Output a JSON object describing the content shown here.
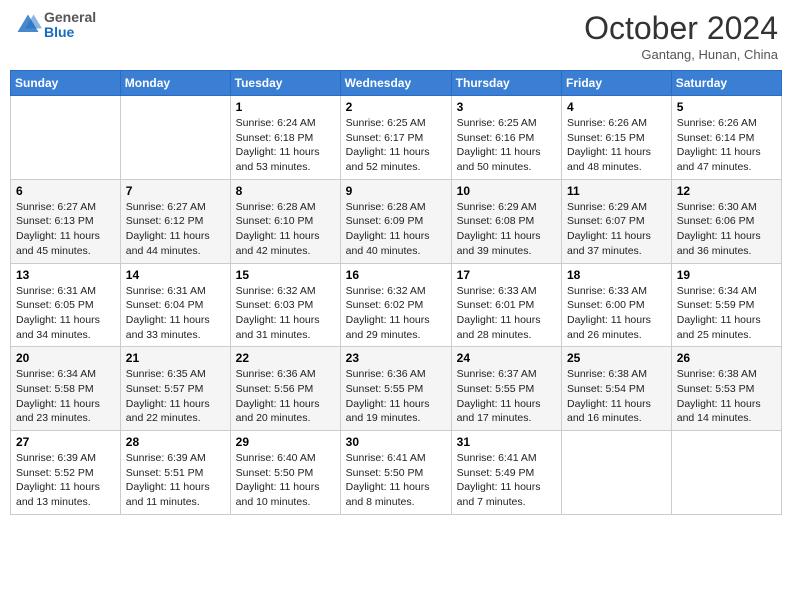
{
  "header": {
    "logo": {
      "general": "General",
      "blue": "Blue"
    },
    "title": "October 2024",
    "location": "Gantang, Hunan, China"
  },
  "days_of_week": [
    "Sunday",
    "Monday",
    "Tuesday",
    "Wednesday",
    "Thursday",
    "Friday",
    "Saturday"
  ],
  "weeks": [
    [
      {
        "day": "",
        "sunrise": "",
        "sunset": "",
        "daylight": ""
      },
      {
        "day": "",
        "sunrise": "",
        "sunset": "",
        "daylight": ""
      },
      {
        "day": "1",
        "sunrise": "Sunrise: 6:24 AM",
        "sunset": "Sunset: 6:18 PM",
        "daylight": "Daylight: 11 hours and 53 minutes."
      },
      {
        "day": "2",
        "sunrise": "Sunrise: 6:25 AM",
        "sunset": "Sunset: 6:17 PM",
        "daylight": "Daylight: 11 hours and 52 minutes."
      },
      {
        "day": "3",
        "sunrise": "Sunrise: 6:25 AM",
        "sunset": "Sunset: 6:16 PM",
        "daylight": "Daylight: 11 hours and 50 minutes."
      },
      {
        "day": "4",
        "sunrise": "Sunrise: 6:26 AM",
        "sunset": "Sunset: 6:15 PM",
        "daylight": "Daylight: 11 hours and 48 minutes."
      },
      {
        "day": "5",
        "sunrise": "Sunrise: 6:26 AM",
        "sunset": "Sunset: 6:14 PM",
        "daylight": "Daylight: 11 hours and 47 minutes."
      }
    ],
    [
      {
        "day": "6",
        "sunrise": "Sunrise: 6:27 AM",
        "sunset": "Sunset: 6:13 PM",
        "daylight": "Daylight: 11 hours and 45 minutes."
      },
      {
        "day": "7",
        "sunrise": "Sunrise: 6:27 AM",
        "sunset": "Sunset: 6:12 PM",
        "daylight": "Daylight: 11 hours and 44 minutes."
      },
      {
        "day": "8",
        "sunrise": "Sunrise: 6:28 AM",
        "sunset": "Sunset: 6:10 PM",
        "daylight": "Daylight: 11 hours and 42 minutes."
      },
      {
        "day": "9",
        "sunrise": "Sunrise: 6:28 AM",
        "sunset": "Sunset: 6:09 PM",
        "daylight": "Daylight: 11 hours and 40 minutes."
      },
      {
        "day": "10",
        "sunrise": "Sunrise: 6:29 AM",
        "sunset": "Sunset: 6:08 PM",
        "daylight": "Daylight: 11 hours and 39 minutes."
      },
      {
        "day": "11",
        "sunrise": "Sunrise: 6:29 AM",
        "sunset": "Sunset: 6:07 PM",
        "daylight": "Daylight: 11 hours and 37 minutes."
      },
      {
        "day": "12",
        "sunrise": "Sunrise: 6:30 AM",
        "sunset": "Sunset: 6:06 PM",
        "daylight": "Daylight: 11 hours and 36 minutes."
      }
    ],
    [
      {
        "day": "13",
        "sunrise": "Sunrise: 6:31 AM",
        "sunset": "Sunset: 6:05 PM",
        "daylight": "Daylight: 11 hours and 34 minutes."
      },
      {
        "day": "14",
        "sunrise": "Sunrise: 6:31 AM",
        "sunset": "Sunset: 6:04 PM",
        "daylight": "Daylight: 11 hours and 33 minutes."
      },
      {
        "day": "15",
        "sunrise": "Sunrise: 6:32 AM",
        "sunset": "Sunset: 6:03 PM",
        "daylight": "Daylight: 11 hours and 31 minutes."
      },
      {
        "day": "16",
        "sunrise": "Sunrise: 6:32 AM",
        "sunset": "Sunset: 6:02 PM",
        "daylight": "Daylight: 11 hours and 29 minutes."
      },
      {
        "day": "17",
        "sunrise": "Sunrise: 6:33 AM",
        "sunset": "Sunset: 6:01 PM",
        "daylight": "Daylight: 11 hours and 28 minutes."
      },
      {
        "day": "18",
        "sunrise": "Sunrise: 6:33 AM",
        "sunset": "Sunset: 6:00 PM",
        "daylight": "Daylight: 11 hours and 26 minutes."
      },
      {
        "day": "19",
        "sunrise": "Sunrise: 6:34 AM",
        "sunset": "Sunset: 5:59 PM",
        "daylight": "Daylight: 11 hours and 25 minutes."
      }
    ],
    [
      {
        "day": "20",
        "sunrise": "Sunrise: 6:34 AM",
        "sunset": "Sunset: 5:58 PM",
        "daylight": "Daylight: 11 hours and 23 minutes."
      },
      {
        "day": "21",
        "sunrise": "Sunrise: 6:35 AM",
        "sunset": "Sunset: 5:57 PM",
        "daylight": "Daylight: 11 hours and 22 minutes."
      },
      {
        "day": "22",
        "sunrise": "Sunrise: 6:36 AM",
        "sunset": "Sunset: 5:56 PM",
        "daylight": "Daylight: 11 hours and 20 minutes."
      },
      {
        "day": "23",
        "sunrise": "Sunrise: 6:36 AM",
        "sunset": "Sunset: 5:55 PM",
        "daylight": "Daylight: 11 hours and 19 minutes."
      },
      {
        "day": "24",
        "sunrise": "Sunrise: 6:37 AM",
        "sunset": "Sunset: 5:55 PM",
        "daylight": "Daylight: 11 hours and 17 minutes."
      },
      {
        "day": "25",
        "sunrise": "Sunrise: 6:38 AM",
        "sunset": "Sunset: 5:54 PM",
        "daylight": "Daylight: 11 hours and 16 minutes."
      },
      {
        "day": "26",
        "sunrise": "Sunrise: 6:38 AM",
        "sunset": "Sunset: 5:53 PM",
        "daylight": "Daylight: 11 hours and 14 minutes."
      }
    ],
    [
      {
        "day": "27",
        "sunrise": "Sunrise: 6:39 AM",
        "sunset": "Sunset: 5:52 PM",
        "daylight": "Daylight: 11 hours and 13 minutes."
      },
      {
        "day": "28",
        "sunrise": "Sunrise: 6:39 AM",
        "sunset": "Sunset: 5:51 PM",
        "daylight": "Daylight: 11 hours and 11 minutes."
      },
      {
        "day": "29",
        "sunrise": "Sunrise: 6:40 AM",
        "sunset": "Sunset: 5:50 PM",
        "daylight": "Daylight: 11 hours and 10 minutes."
      },
      {
        "day": "30",
        "sunrise": "Sunrise: 6:41 AM",
        "sunset": "Sunset: 5:50 PM",
        "daylight": "Daylight: 11 hours and 8 minutes."
      },
      {
        "day": "31",
        "sunrise": "Sunrise: 6:41 AM",
        "sunset": "Sunset: 5:49 PM",
        "daylight": "Daylight: 11 hours and 7 minutes."
      },
      {
        "day": "",
        "sunrise": "",
        "sunset": "",
        "daylight": ""
      },
      {
        "day": "",
        "sunrise": "",
        "sunset": "",
        "daylight": ""
      }
    ]
  ]
}
